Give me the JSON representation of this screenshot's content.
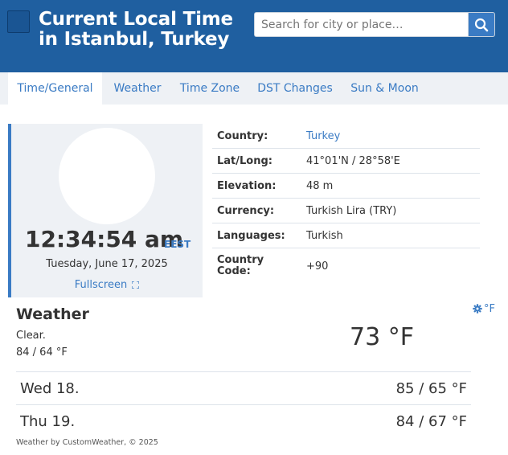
{
  "header": {
    "title": "Current Local Time in Istanbul, Turkey",
    "search_placeholder": "Search for city or place…"
  },
  "tabs": [
    {
      "label": "Time/General",
      "active": true
    },
    {
      "label": "Weather",
      "active": false
    },
    {
      "label": "Time Zone",
      "active": false
    },
    {
      "label": "DST Changes",
      "active": false
    },
    {
      "label": "Sun & Moon",
      "active": false
    }
  ],
  "clock": {
    "time": "12:34:54 am",
    "timezone": "EEST",
    "date": "Tuesday, June 17, 2025",
    "fullscreen_label": "Fullscreen"
  },
  "info": [
    {
      "label": "Country:",
      "value": "Turkey",
      "link": true
    },
    {
      "label": "Lat/Long:",
      "value": "41°01'N / 28°58'E",
      "link": false
    },
    {
      "label": "Elevation:",
      "value": "48 m",
      "link": false
    },
    {
      "label": "Currency:",
      "value": "Turkish Lira (TRY)",
      "link": false
    },
    {
      "label": "Languages:",
      "value": "Turkish",
      "link": false
    },
    {
      "label": "Country Code:",
      "value": "+90",
      "link": false
    }
  ],
  "weather": {
    "title": "Weather",
    "unit_label": "°F",
    "description": "Clear.",
    "hilo": "84 / 64 °F",
    "current_temp": "73 °F",
    "forecast": [
      {
        "day": "Wed 18.",
        "temp": "85 / 65 °F"
      },
      {
        "day": "Thu 19.",
        "temp": "84 / 67 °F"
      }
    ],
    "credit": "Weather by CustomWeather, © 2025"
  },
  "colors": {
    "header_bg": "#1f5fa0",
    "accent": "#3a7bc4",
    "panel_bg": "#eef1f5"
  }
}
